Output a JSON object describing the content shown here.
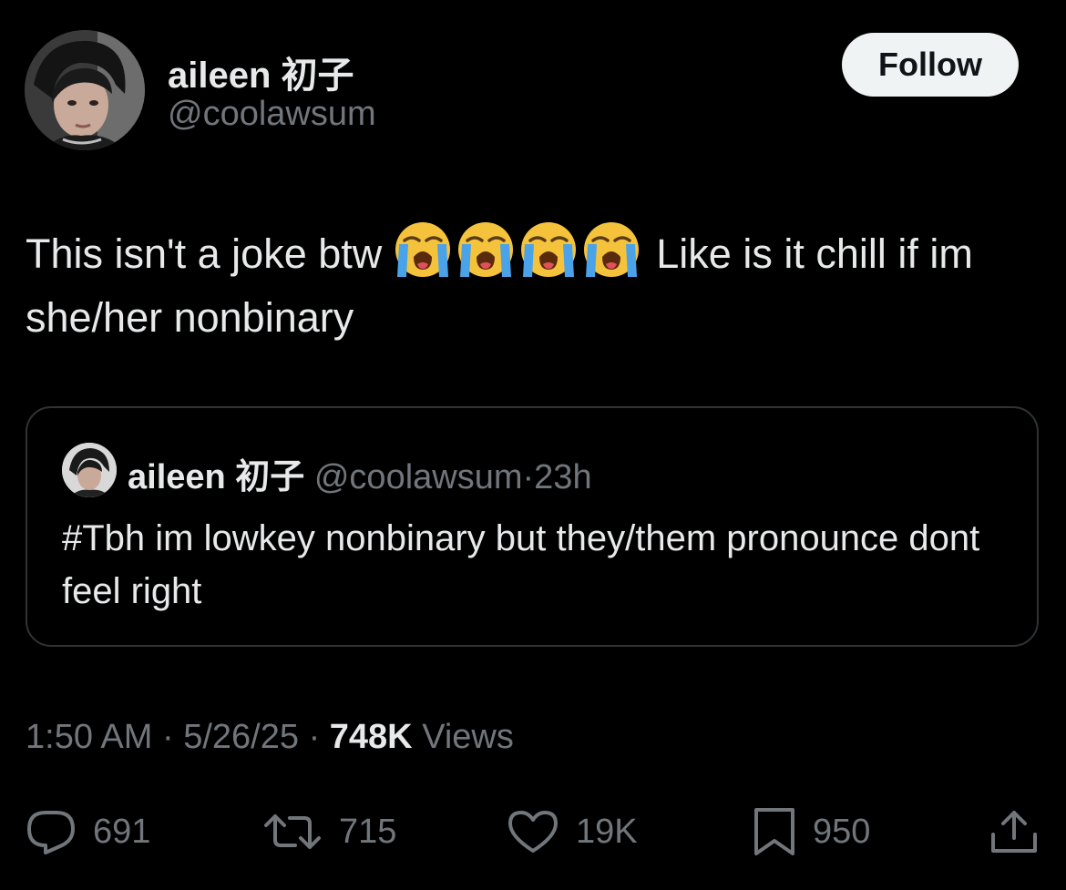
{
  "author": {
    "display_name": "aileen 初子",
    "handle": "@coolawsum"
  },
  "follow_button": {
    "label": "Follow"
  },
  "tweet": {
    "text_part1": "This isn't a joke btw",
    "emoji_name": "loudly-crying-face",
    "emoji_count": 4,
    "text_part2": "Like is it chill if im she/her nonbinary"
  },
  "quoted_tweet": {
    "display_name": "aileen 初子",
    "handle": "@coolawsum",
    "separator": "·",
    "age": "23h",
    "text": "#Tbh im lowkey nonbinary but they/them pronounce dont feel right"
  },
  "meta": {
    "time": "1:50 AM",
    "separator": "·",
    "date": "5/26/25",
    "views_count": "748K",
    "views_label": "Views"
  },
  "actions": {
    "replies": "691",
    "reposts": "715",
    "likes": "19K",
    "bookmarks": "950"
  },
  "icons": {
    "reply": "reply-icon",
    "repost": "repost-icon",
    "like": "heart-icon",
    "bookmark": "bookmark-icon",
    "share": "share-icon"
  },
  "colors": {
    "background": "#000000",
    "text_primary": "#e7e9ea",
    "text_secondary": "#71767b",
    "border": "#2f3336",
    "follow_bg": "#eff3f4",
    "follow_text": "#0f1419"
  }
}
